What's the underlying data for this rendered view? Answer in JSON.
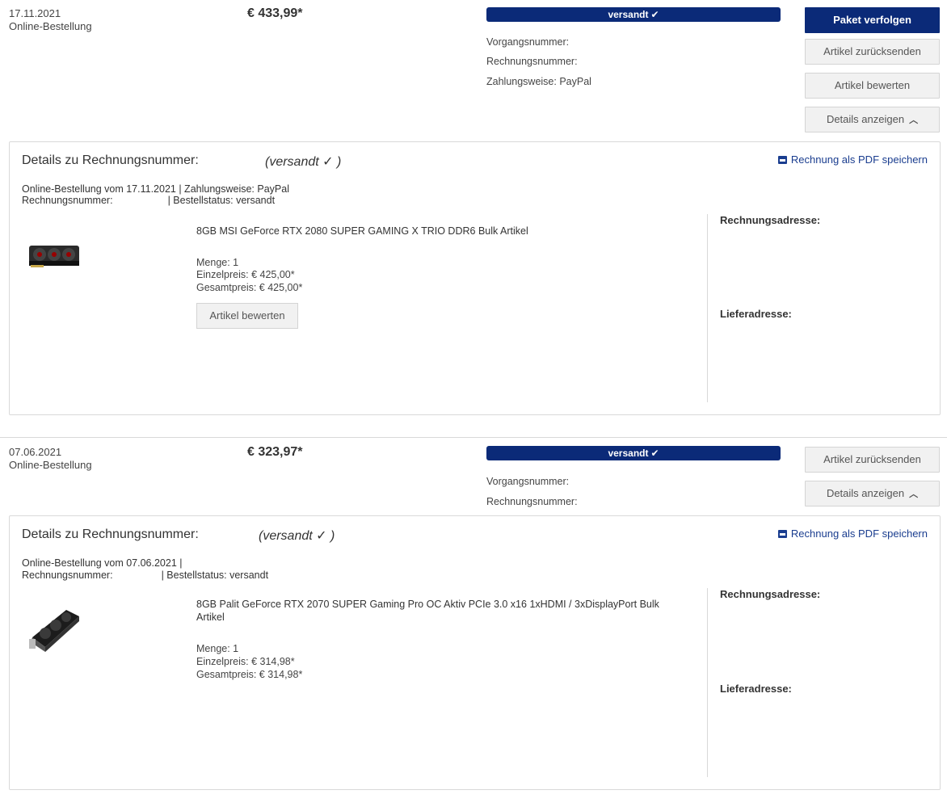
{
  "orders": [
    {
      "date": "17.11.2021",
      "type": "Online-Bestellung",
      "price": "€ 433,99*",
      "status": "versandt",
      "status_check": "✔",
      "vorgang": "Vorgangsnummer:",
      "rechnung": "Rechnungsnummer:",
      "zahlung": "Zahlungsweise: PayPal",
      "buttons": {
        "track": "Paket verfolgen",
        "return": "Artikel zurücksenden",
        "rate": "Artikel bewerten",
        "details": "Details anzeigen"
      },
      "panel": {
        "title": "Details zu Rechnungsnummer:",
        "status": "(versandt ✓ )",
        "pdf": "Rechnung als PDF speichern",
        "line1": "Online-Bestellung vom 17.11.2021 | Zahlungsweise: PayPal",
        "line2_label": "Rechnungsnummer:",
        "line2_status": "| Bestellstatus: versandt",
        "item_name": "8GB MSI GeForce RTX 2080 SUPER GAMING X TRIO DDR6 Bulk Artikel",
        "qty": "Menge: 1",
        "unit_price": "Einzelpreis: € 425,00*",
        "total_price": "Gesamtpreis: € 425,00*",
        "rate_button": "Artikel bewerten",
        "billing": "Rechnungsadresse:",
        "shipping": "Lieferadresse:"
      }
    },
    {
      "date": "07.06.2021",
      "type": "Online-Bestellung",
      "price": "€ 323,97*",
      "status": "versandt",
      "status_check": "✔",
      "vorgang": "Vorgangsnummer:",
      "rechnung": "Rechnungsnummer:",
      "buttons": {
        "return": "Artikel zurücksenden",
        "details": "Details anzeigen"
      },
      "panel": {
        "title": "Details zu Rechnungsnummer:",
        "status": "(versandt ✓ )",
        "pdf": "Rechnung als PDF speichern",
        "line1": "Online-Bestellung vom 07.06.2021 |",
        "line2_label": "Rechnungsnummer:",
        "line2_status": "| Bestellstatus: versandt",
        "item_name": "8GB Palit GeForce RTX 2070 SUPER Gaming Pro OC Aktiv PCIe 3.0 x16 1xHDMI / 3xDisplayPort Bulk Artikel",
        "qty": "Menge: 1",
        "unit_price": "Einzelpreis: € 314,98*",
        "total_price": "Gesamtpreis: € 314,98*",
        "billing": "Rechnungsadresse:",
        "shipping": "Lieferadresse:"
      }
    }
  ],
  "colors": {
    "brand": "#0b2a78",
    "link": "#1a3d8f",
    "border": "#d9d9d9",
    "button_bg": "#f1f1f1"
  },
  "icons": {
    "check": "check-icon",
    "caret": "chevron-up-icon",
    "printer": "printer-icon"
  }
}
